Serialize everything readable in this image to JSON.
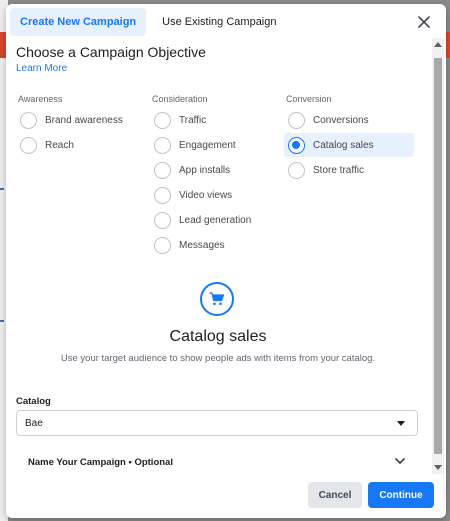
{
  "tabs": [
    {
      "label": "Create New Campaign",
      "active": true
    },
    {
      "label": "Use Existing Campaign",
      "active": false
    }
  ],
  "heading": "Choose a Campaign Objective",
  "learn_more": "Learn More",
  "columns": [
    {
      "title": "Awareness",
      "options": [
        "Brand awareness",
        "Reach"
      ]
    },
    {
      "title": "Consideration",
      "options": [
        "Traffic",
        "Engagement",
        "App installs",
        "Video views",
        "Lead generation",
        "Messages"
      ]
    },
    {
      "title": "Conversion",
      "options": [
        "Conversions",
        "Catalog sales",
        "Store traffic"
      ]
    }
  ],
  "selected_objective": "Catalog sales",
  "objective_panel": {
    "icon": "shopping-cart-icon",
    "title": "Catalog sales",
    "description": "Use your target audience to show people ads with items from your catalog."
  },
  "catalog": {
    "label": "Catalog",
    "value": "Bae"
  },
  "name_campaign_label": "Name Your Campaign • Optional",
  "footer": {
    "cancel": "Cancel",
    "continue": "Continue"
  },
  "colors": {
    "accent": "#1877f2",
    "selected_bg": "#e7f0fd"
  }
}
